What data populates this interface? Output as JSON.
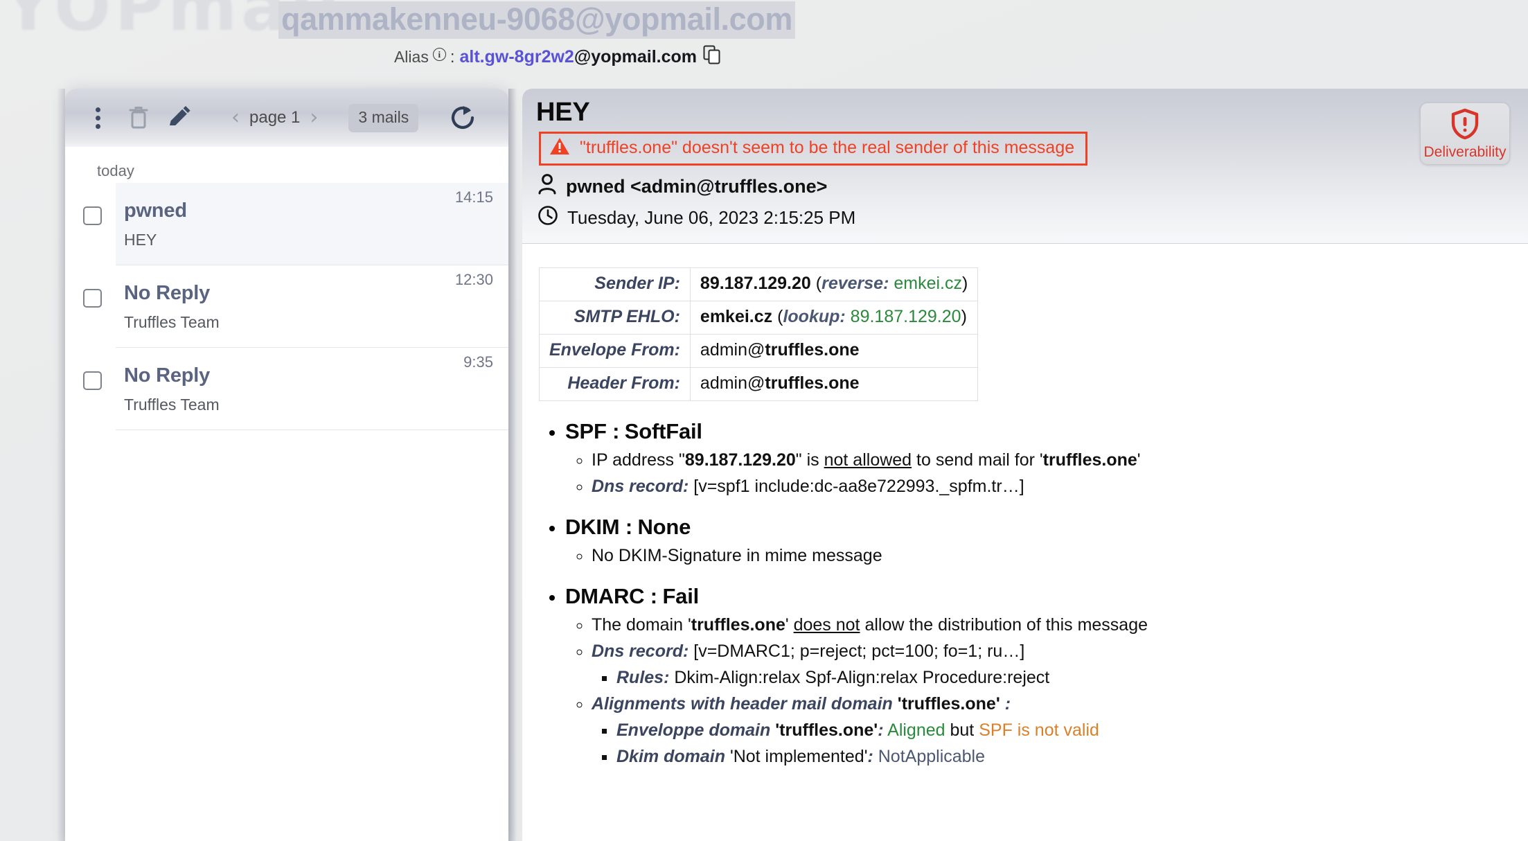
{
  "account": {
    "email": "qammakenneu-9068@yopmail.com",
    "alias_label": "Alias",
    "info_icon": "info-circle-icon",
    "alias_separator": ":",
    "alias_user": "alt.gw-8gr2w2",
    "alias_domain": "@yopmail.com",
    "copy_icon": "copy-icon"
  },
  "maillist": {
    "toolbar": {
      "menu_icon": "kebab-menu-icon",
      "delete_icon": "trash-icon",
      "compose_icon": "pencil-icon",
      "prev_icon": "chevron-left-icon",
      "next_icon": "chevron-right-icon",
      "page_label": "page 1",
      "count_badge": "3 mails",
      "refresh_icon": "refresh-icon"
    },
    "group_label": "today",
    "items": [
      {
        "from": "pwned",
        "subject": "HEY",
        "time": "14:15",
        "selected": true
      },
      {
        "from": "No Reply",
        "subject": "Truffles Team",
        "time": "12:30",
        "selected": false
      },
      {
        "from": "No Reply",
        "subject": "Truffles Team",
        "time": "9:35",
        "selected": false
      }
    ]
  },
  "message": {
    "subject": "HEY",
    "warning_icon": "warning-triangle-icon",
    "warning": "\"truffles.one\" doesn't seem to be the real sender of this message",
    "sender_icon": "person-icon",
    "sender": "pwned <admin@truffles.one>",
    "clock_icon": "clock-icon",
    "date": "Tuesday, June 06, 2023 2:15:25 PM",
    "deliverability": {
      "icon": "shield-alert-icon",
      "label": "Deliverability",
      "color": "#d8352a"
    }
  },
  "analysis": {
    "table": [
      {
        "key": "Sender IP:",
        "value_bold": "89.187.129.20",
        "paren_label": "reverse:",
        "paren_value": "emkei.cz",
        "paren_green": true
      },
      {
        "key": "SMTP EHLO:",
        "value_bold": "emkei.cz",
        "paren_label": "lookup:",
        "paren_value": "89.187.129.20",
        "paren_green": true
      },
      {
        "key": "Envelope From:",
        "value_plain": "admin@",
        "value_bold": "truffles.one"
      },
      {
        "key": "Header From:",
        "value_plain": "admin@",
        "value_bold": "truffles.one"
      }
    ],
    "spf": {
      "name": "SPF :",
      "result": "SoftFail",
      "result_color": "#d9812a",
      "line1_a": "IP address \"",
      "line1_ip": "89.187.129.20",
      "line1_b": "\" is ",
      "line1_underline": "not allowed",
      "line1_c": " to send mail for '",
      "line1_domain": "truffles.one",
      "line1_d": "'",
      "dns_label": "Dns record:",
      "dns_value": "[v=spf1 include:dc-aa8e722993._spfm.tr…]"
    },
    "dkim": {
      "name": "DKIM :",
      "result": "None",
      "result_color": "#4c5873",
      "detail": "No DKIM-Signature in mime message"
    },
    "dmarc": {
      "name": "DMARC :",
      "result": "Fail",
      "result_color": "#e41f14",
      "line1_a": "The domain '",
      "line1_domain": "truffles.one",
      "line1_b": "' ",
      "line1_underline": "does not",
      "line1_c": " allow the distribution of this message",
      "dns_label": "Dns record:",
      "dns_value": "[v=DMARC1; p=reject; pct=100; fo=1; ru…]",
      "rules_label": "Rules:",
      "rules_value": "Dkim-Align:relax Spf-Align:relax Procedure:reject",
      "align_label": "Alignments with header mail domain",
      "align_domain": "'truffles.one'",
      "align_colon": ":",
      "env_label": "Enveloppe domain",
      "env_domain": "'truffles.one'",
      "env_colon": ":",
      "env_status": "Aligned",
      "env_but": "but",
      "env_note": "SPF is not valid",
      "dkim_label": "Dkim domain",
      "dkim_domain": "'Not implemented'",
      "dkim_colon": ":",
      "dkim_status": "NotApplicable"
    }
  }
}
